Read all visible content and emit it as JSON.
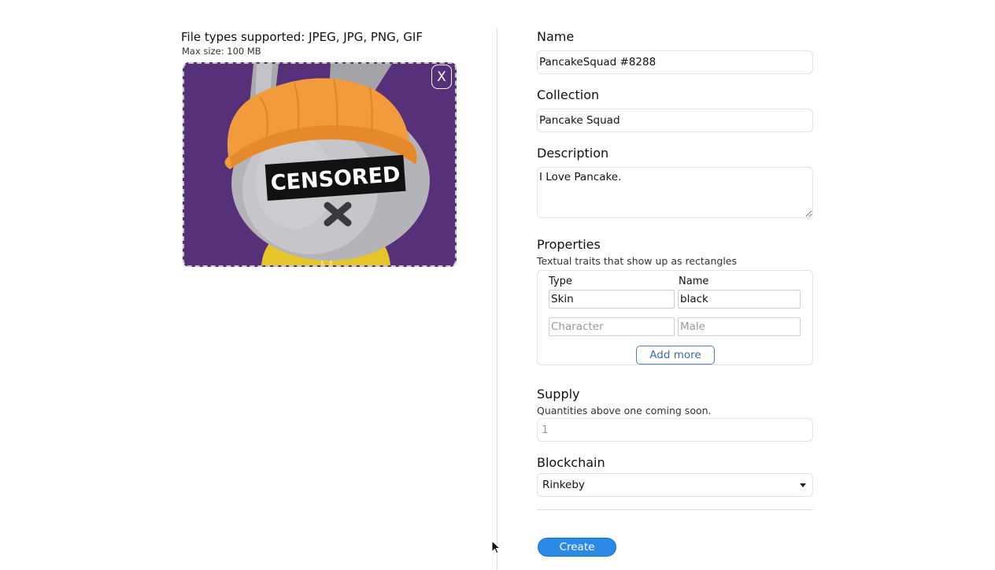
{
  "upload": {
    "file_types": "File types supported: JPEG, JPG, PNG, GIF",
    "max_size": "Max size: 100 MB",
    "preview_text": "CENSORED",
    "close_label": "X"
  },
  "form": {
    "name": {
      "label": "Name",
      "value": "PancakeSquad #8288"
    },
    "collection": {
      "label": "Collection",
      "value": "Pancake Squad"
    },
    "description": {
      "label": "Description",
      "value": "I Love Pancake."
    },
    "properties": {
      "label": "Properties",
      "hint": "Textual traits that show up as rectangles",
      "type_header": "Type",
      "name_header": "Name",
      "rows": [
        {
          "type": "Skin",
          "name": "black"
        },
        {
          "type_placeholder": "Character",
          "name_placeholder": "Male"
        }
      ],
      "add_more_label": "Add more"
    },
    "supply": {
      "label": "Supply",
      "hint": "Quantities above one coming soon.",
      "placeholder": "1"
    },
    "blockchain": {
      "label": "Blockchain",
      "value": "Rinkeby"
    },
    "create_label": "Create"
  },
  "colors": {
    "preview_background": "#57307a",
    "create_button": "#2a8ae6",
    "add_more_border": "#4a7fb8"
  },
  "icons": {
    "close": "close-icon",
    "dropdown": "chevron-down-icon",
    "cursor": "mouse-pointer-icon"
  }
}
